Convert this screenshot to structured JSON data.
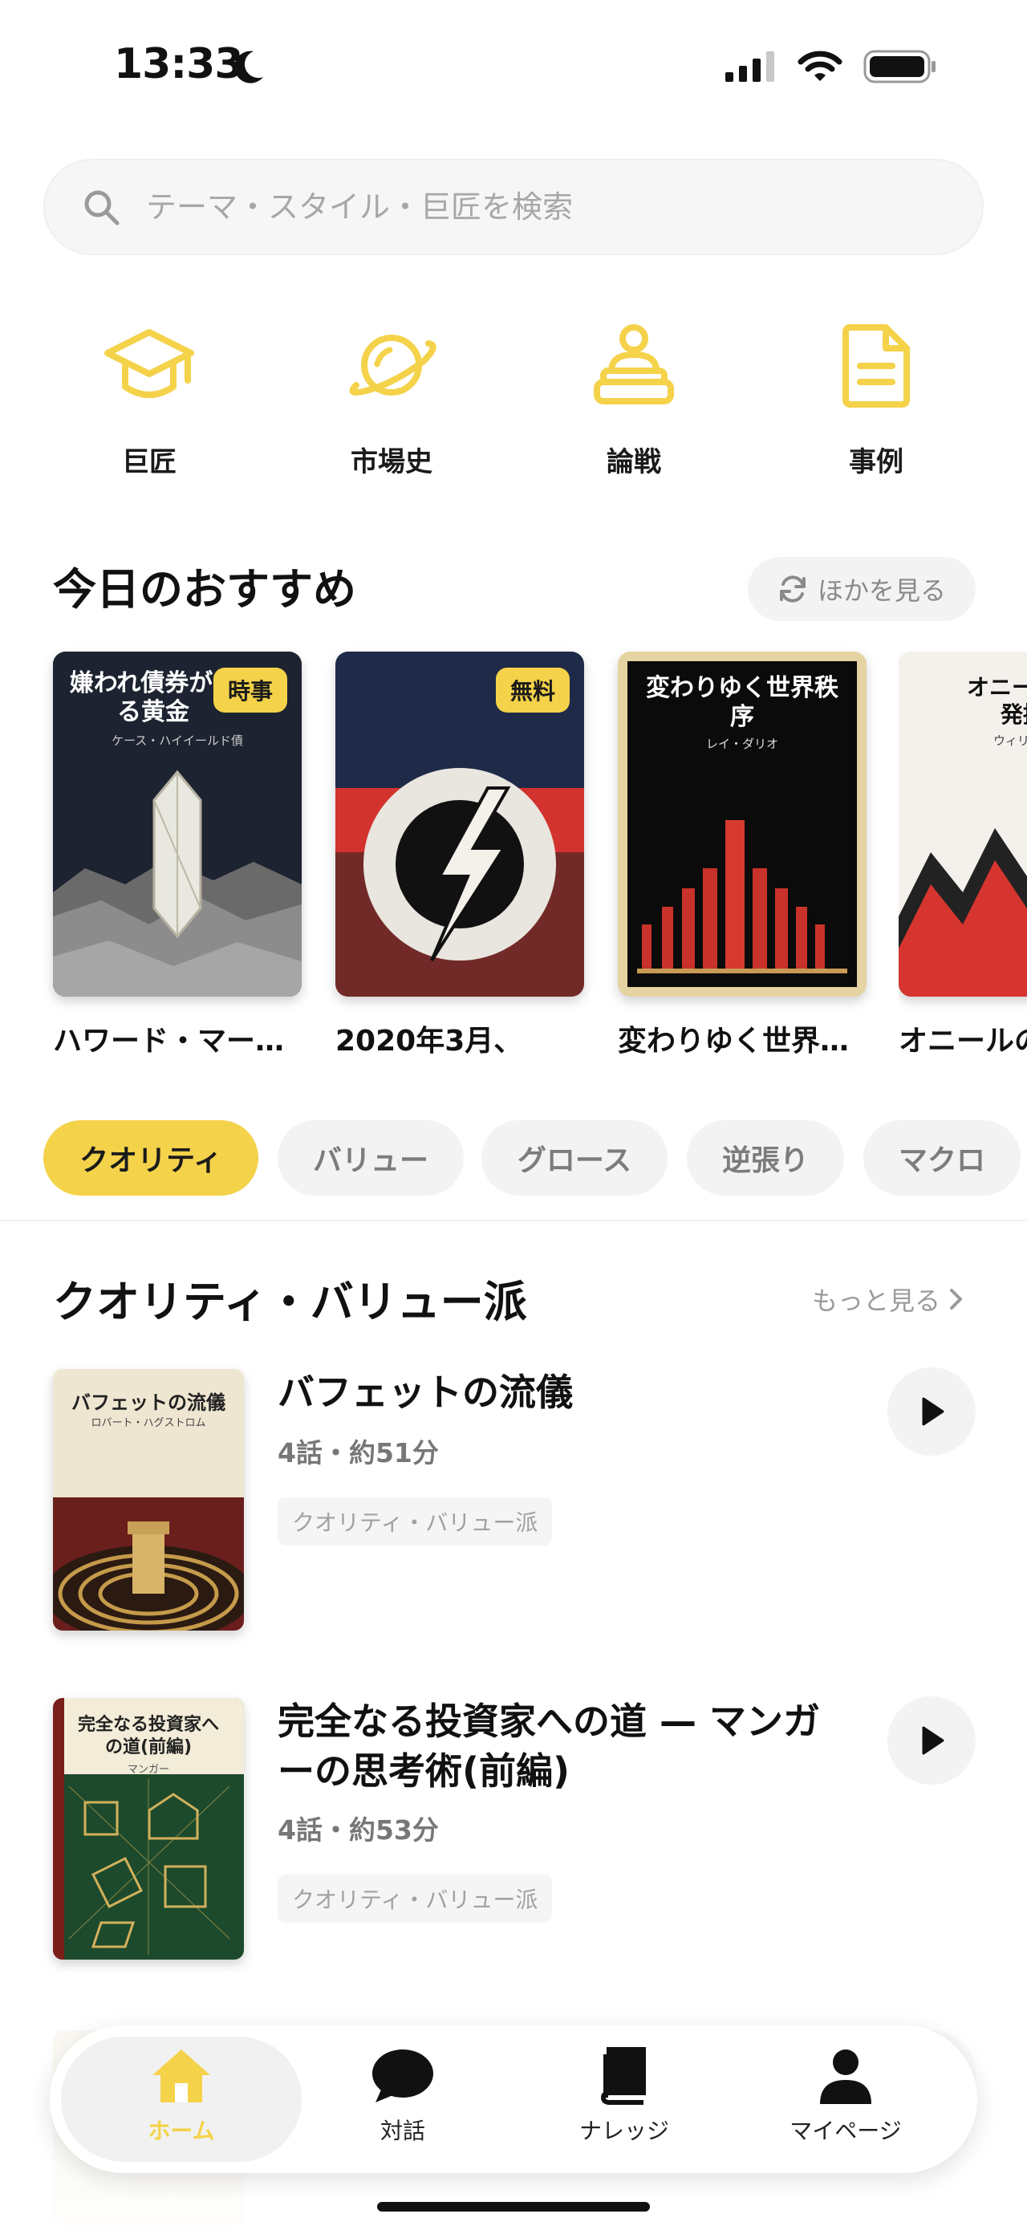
{
  "status_bar": {
    "time": "13:33"
  },
  "search": {
    "placeholder": "テーマ・スタイル・巨匠を検索"
  },
  "categories": [
    {
      "label": "巨匠",
      "icon": "graduation-cap-icon"
    },
    {
      "label": "市場史",
      "icon": "planet-icon"
    },
    {
      "label": "論戦",
      "icon": "podium-icon"
    },
    {
      "label": "事例",
      "icon": "document-icon"
    }
  ],
  "recommend": {
    "title": "今日のおすすめ",
    "more_label": "ほかを見る",
    "books": [
      {
        "cover_title": "嫌われ債券が生\nる黄金",
        "cover_author": "ケース・ハイイールド債",
        "badge": "時事",
        "title": "ハワード・マークス"
      },
      {
        "cover_title": "",
        "cover_author": "",
        "badge": "無料",
        "title": "2020年3月、"
      },
      {
        "cover_title": "変わりゆく世界秩\n序",
        "cover_author": "レイ・ダリオ",
        "badge": "",
        "title": "変わりゆく世界秩序"
      },
      {
        "cover_title": "オニールの\n発掘",
        "cover_author": "ウィリアム",
        "badge": "",
        "title": "オニールの"
      }
    ]
  },
  "filters": [
    "クオリティ",
    "バリュー",
    "グロース",
    "逆張り",
    "マクロ"
  ],
  "active_filter": "クオリティ",
  "quality_section": {
    "title": "クオリティ・バリュー派",
    "more_label": "もっと見る",
    "items": [
      {
        "cover_title": "バフェットの流儀",
        "cover_author": "ロバート・ハグストロム",
        "title": "バフェットの流儀",
        "meta": "4話・約51分",
        "tag": "クオリティ・バリュー派"
      },
      {
        "cover_title": "完全なる投資家へ\nの道(前編)",
        "cover_author": "マンガー",
        "title": "完全なる投資家への道 — マンガーの思考術(前編)",
        "meta": "4話・約53分",
        "tag": "クオリティ・バリュー派"
      }
    ]
  },
  "nav": [
    {
      "label": "ホーム",
      "icon": "home-icon",
      "active": true
    },
    {
      "label": "対話",
      "icon": "chat-bubble-icon",
      "active": false
    },
    {
      "label": "ナレッジ",
      "icon": "book-icon",
      "active": false
    },
    {
      "label": "マイページ",
      "icon": "person-icon",
      "active": false
    }
  ],
  "colors": {
    "accent": "#f4d24a",
    "text": "#111111",
    "muted": "#8a8a8a"
  }
}
